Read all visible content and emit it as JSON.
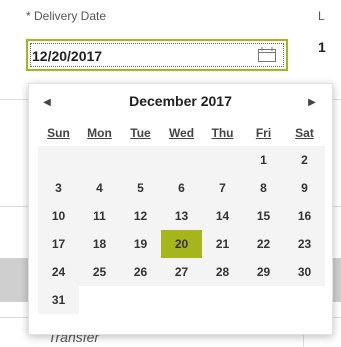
{
  "form": {
    "delivery_label": "* Delivery Date",
    "delivery_value": "12/20/2017",
    "right_label": "L",
    "right_value": "1",
    "transfer_text": "Transfer"
  },
  "calendar": {
    "month_title": "December 2017",
    "prev_icon": "◀",
    "next_icon": "▶",
    "weekdays": [
      "Sun",
      "Mon",
      "Tue",
      "Wed",
      "Thu",
      "Fri",
      "Sat"
    ],
    "weeks": [
      [
        "",
        "",
        "",
        "",
        "",
        "1",
        "2"
      ],
      [
        "3",
        "4",
        "5",
        "6",
        "7",
        "8",
        "9"
      ],
      [
        "10",
        "11",
        "12",
        "13",
        "14",
        "15",
        "16"
      ],
      [
        "17",
        "18",
        "19",
        "20",
        "21",
        "22",
        "23"
      ],
      [
        "24",
        "25",
        "26",
        "27",
        "28",
        "29",
        "30"
      ],
      [
        "31",
        "",
        "",
        "",
        "",
        "",
        ""
      ]
    ],
    "states": [
      [
        "empty",
        "empty",
        "empty",
        "empty",
        "empty",
        "past",
        "past"
      ],
      [
        "past",
        "past",
        "past",
        "past",
        "today",
        "avail",
        "weekend-dim"
      ],
      [
        "weekend-dim",
        "avail",
        "avail",
        "avail",
        "avail",
        "avail",
        "weekend-dim"
      ],
      [
        "weekend-dim",
        "avail",
        "avail",
        "selected",
        "avail",
        "avail",
        "weekend-dim"
      ],
      [
        "weekend-dim",
        "avail",
        "avail",
        "avail",
        "avail",
        "avail",
        "weekend-dim"
      ],
      [
        "weekend-dim",
        "",
        "",
        "",
        "",
        "",
        ""
      ]
    ],
    "selected_color": "#a6b51a",
    "today_color": "#2e84c6"
  }
}
